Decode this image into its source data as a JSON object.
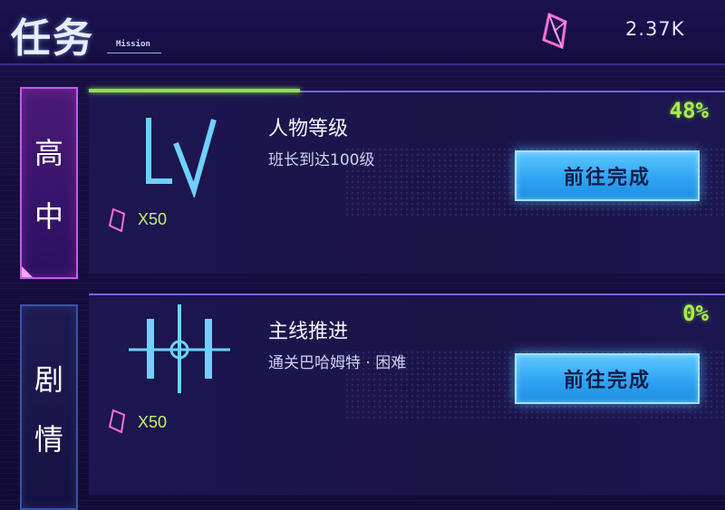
{
  "header": {
    "title": "任务",
    "subtitle": "Mission",
    "currency": {
      "icon": "crystal-icon",
      "value": "2.37K"
    }
  },
  "categories": [
    {
      "label_chars": [
        "高",
        "中"
      ],
      "active": true
    },
    {
      "label_chars": [
        "剧",
        "情"
      ],
      "active": false
    }
  ],
  "missions": [
    {
      "name": "人物等级",
      "description": "班长到达100级",
      "percent_label": "48%",
      "progress": 0.48,
      "reward": {
        "icon": "crystal-icon",
        "amount": "X50"
      },
      "button_label": "前往完成",
      "icon": "level-lv-icon"
    },
    {
      "name": "主线推进",
      "description": "通关巴哈姆特 · 困难",
      "percent_label": "0%",
      "progress": 0,
      "reward": {
        "icon": "crystal-icon",
        "amount": "X50"
      },
      "button_label": "前往完成",
      "icon": "main-story-crosshair-icon"
    }
  ],
  "colors": {
    "accent_green": "#a7ef4a",
    "button_blue": "#2ea4f2",
    "crystal_pink": "#ff7ad9",
    "background": "#140d3a"
  }
}
